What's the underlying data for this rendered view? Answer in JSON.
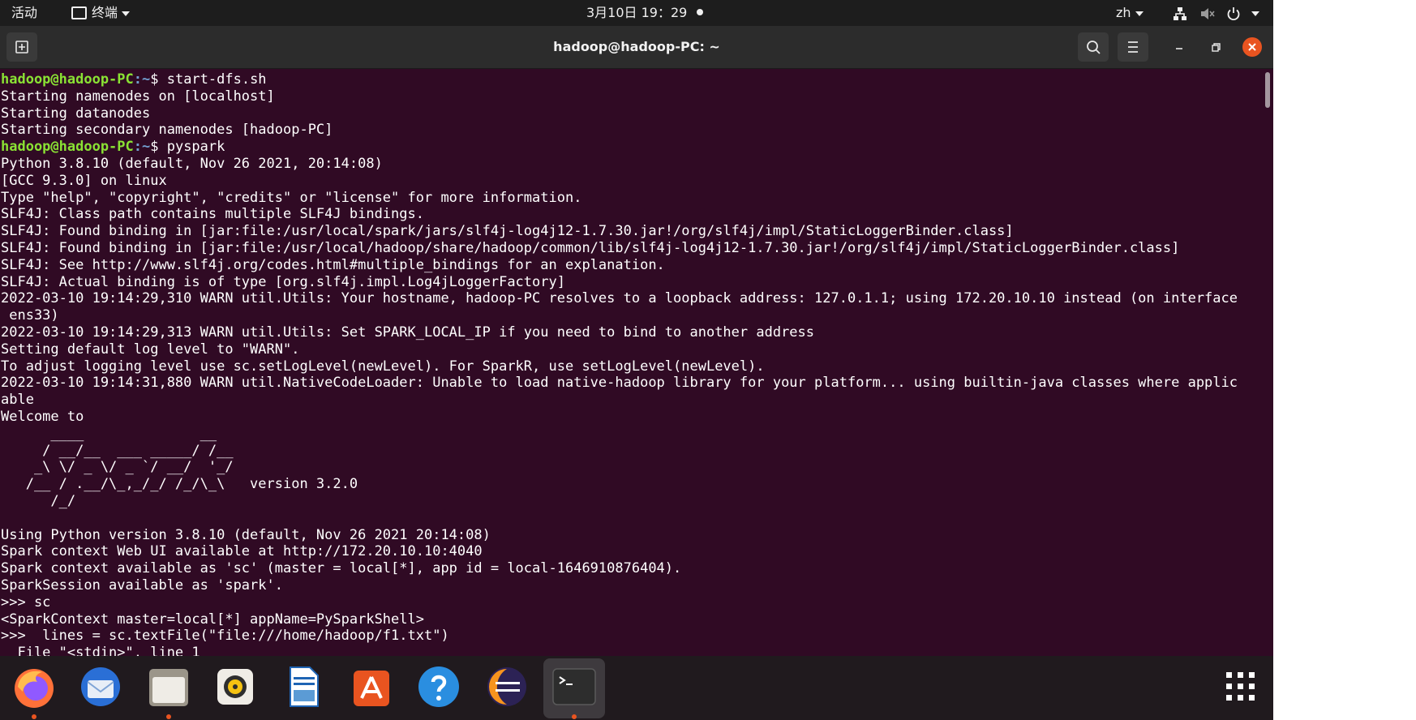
{
  "topbar": {
    "activities": "活动",
    "app_menu": "终端",
    "datetime": "3月10日 19：29",
    "input_method": "zh"
  },
  "window": {
    "title": "hadoop@hadoop-PC: ~"
  },
  "terminal": {
    "prompt_user_host": "hadoop@hadoop-PC",
    "prompt_path": ":~",
    "cmd1": "$ start-dfs.sh",
    "cmd2": "$ pyspark",
    "out1": "Starting namenodes on [localhost]\nStarting datanodes\nStarting secondary namenodes [hadoop-PC]",
    "out2": "Python 3.8.10 (default, Nov 26 2021, 20:14:08)\n[GCC 9.3.0] on linux\nType \"help\", \"copyright\", \"credits\" or \"license\" for more information.\nSLF4J: Class path contains multiple SLF4J bindings.\nSLF4J: Found binding in [jar:file:/usr/local/spark/jars/slf4j-log4j12-1.7.30.jar!/org/slf4j/impl/StaticLoggerBinder.class]\nSLF4J: Found binding in [jar:file:/usr/local/hadoop/share/hadoop/common/lib/slf4j-log4j12-1.7.30.jar!/org/slf4j/impl/StaticLoggerBinder.class]\nSLF4J: See http://www.slf4j.org/codes.html#multiple_bindings for an explanation.\nSLF4J: Actual binding is of type [org.slf4j.impl.Log4jLoggerFactory]\n2022-03-10 19:14:29,310 WARN util.Utils: Your hostname, hadoop-PC resolves to a loopback address: 127.0.1.1; using 172.20.10.10 instead (on interface\n ens33)\n2022-03-10 19:14:29,313 WARN util.Utils: Set SPARK_LOCAL_IP if you need to bind to another address\nSetting default log level to \"WARN\".\nTo adjust logging level use sc.setLogLevel(newLevel). For SparkR, use setLogLevel(newLevel).\n2022-03-10 19:14:31,880 WARN util.NativeCodeLoader: Unable to load native-hadoop library for your platform... using builtin-java classes where applic\nable\nWelcome to\n      ____              __\n     / __/__  ___ _____/ /__\n    _\\ \\/ _ \\/ _ `/ __/  '_/\n   /__ / .__/\\_,_/_/ /_/\\_\\   version 3.2.0\n      /_/\n\nUsing Python version 3.8.10 (default, Nov 26 2021 20:14:08)\nSpark context Web UI available at http://172.20.10.10:4040\nSpark context available as 'sc' (master = local[*], app id = local-1646910876404).\nSparkSession available as 'spark'.\n>>> sc\n<SparkContext master=local[*] appName=PySparkShell>\n>>>  lines = sc.textFile(\"file:///home/hadoop/f1.txt\")\n  File \"<stdin>\", line 1"
  },
  "dock": {
    "apps": [
      "firefox-icon",
      "thunderbird-icon",
      "files-icon",
      "rhythmbox-icon",
      "writer-icon",
      "software-icon",
      "help-icon",
      "eclipse-icon",
      "terminal-icon"
    ]
  },
  "colors": {
    "terminal_bg": "#300a24",
    "prompt_green": "#8ae234",
    "prompt_blue": "#729fcf",
    "accent": "#e95420"
  }
}
